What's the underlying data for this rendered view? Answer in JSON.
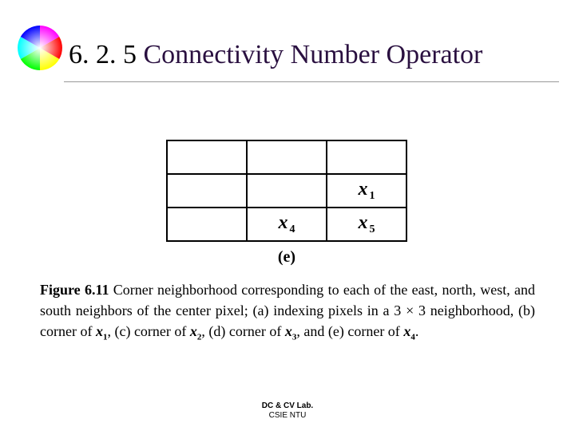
{
  "title": {
    "section": "6. 2. 5",
    "text": "Connectivity Number Operator"
  },
  "figure": {
    "cells": [
      [
        "",
        "",
        ""
      ],
      [
        "",
        "",
        "x1"
      ],
      [
        "",
        "x4",
        "x5"
      ]
    ],
    "label": "(e)"
  },
  "caption": {
    "fig_no": "Figure 6.11",
    "parts": [
      "Corner neighborhood corresponding to each of the east, north, west, and south neighbors of the center pixel; (a) indexing pixels in a 3 × 3 neighborhood, (b) corner of ",
      "x1",
      ", (c) corner of ",
      "x2",
      ", (d) corner of ",
      "x3",
      ", and (e) corner of ",
      "x4",
      "."
    ]
  },
  "footer": {
    "lab": "DC & CV Lab.",
    "dept": "CSIE NTU"
  }
}
